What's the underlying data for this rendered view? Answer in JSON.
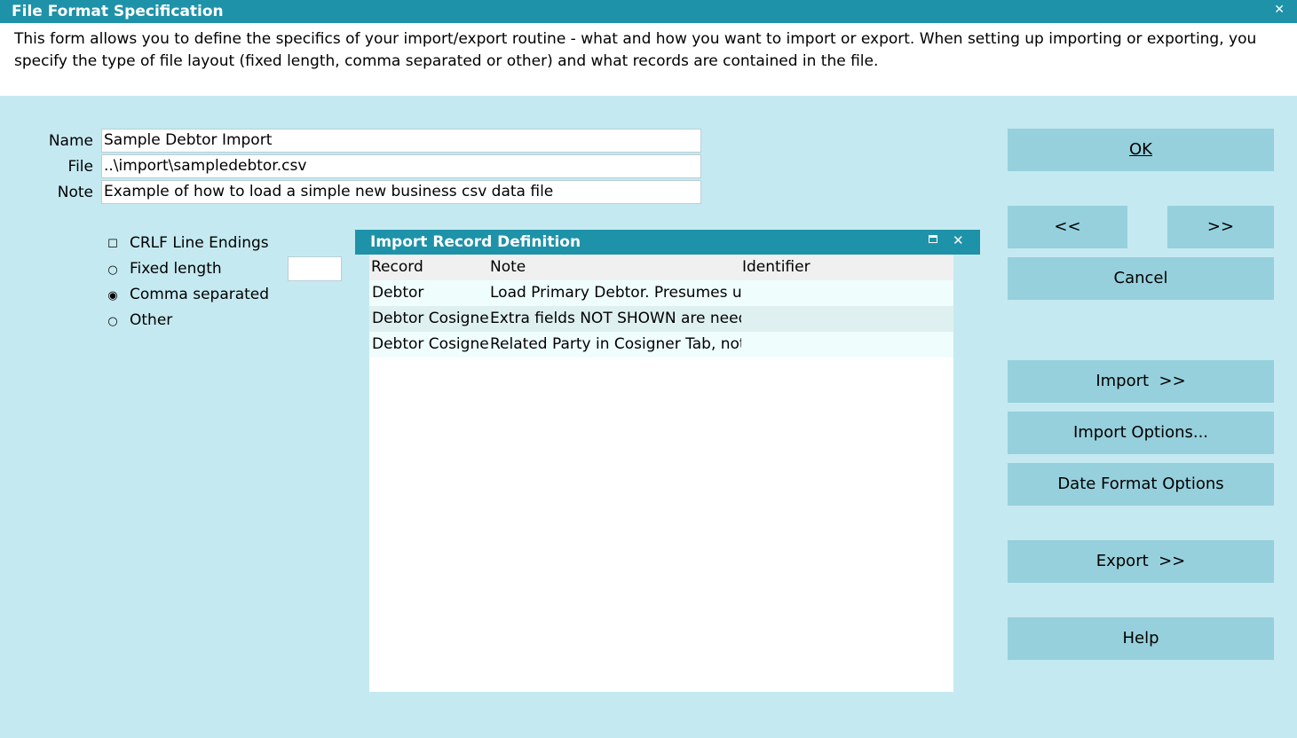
{
  "window": {
    "title": "File Format Specification",
    "close_glyph": "✕"
  },
  "description": "This form allows you to define the specifics of your import/export routine - what and how you want to import or export. When setting up importing or exporting, you specify the type of file layout (fixed length, comma separated or other) and what records are contained in the file.",
  "form": {
    "name_label": "Name",
    "name_value": "Sample Debtor Import",
    "file_label": "File",
    "file_value": "..\\import\\sampledebtor.csv",
    "note_label": "Note",
    "note_value": "Example of how to load a simple new business csv data file"
  },
  "options": {
    "crlf_label": "CRLF Line Endings",
    "crlf_checked": false,
    "fixed_label": "Fixed length",
    "comma_label": "Comma separated",
    "other_label": "Other",
    "selected": "comma"
  },
  "record_panel": {
    "title": "Import Record Definition",
    "columns": [
      "Record",
      "Note",
      "Identifier"
    ],
    "rows": [
      {
        "record": "Debtor",
        "note": "Load Primary Debtor. Presumes us",
        "identifier": ""
      },
      {
        "record": "Debtor Cosigner",
        "note": "Extra fields NOT SHOWN are need",
        "identifier": ""
      },
      {
        "record": "Debtor Cosigner",
        "note": "Related Party in Cosigner Tab, not",
        "identifier": ""
      }
    ]
  },
  "buttons": {
    "ok": "OK",
    "prev": "<<",
    "next": ">>",
    "cancel": "Cancel",
    "import": "Import  >>",
    "import_options": "Import Options...",
    "date_format": "Date Format Options",
    "export": "Export  >>",
    "help": "Help"
  }
}
